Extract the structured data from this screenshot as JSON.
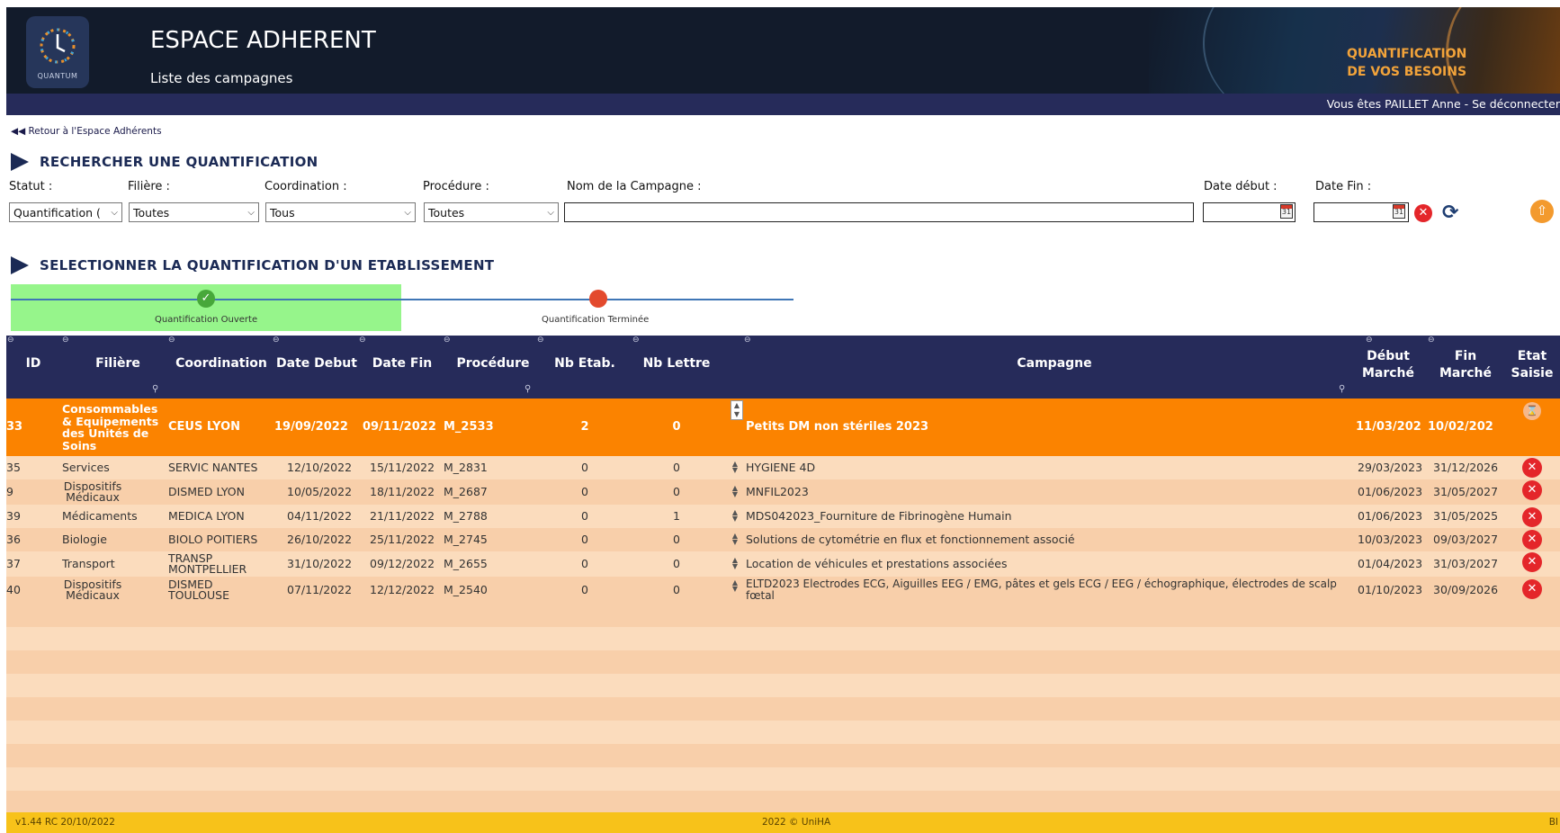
{
  "header": {
    "app_title": "ESPACE ADHERENT",
    "subtitle": "Liste des campagnes",
    "logo_label": "QUANTUM",
    "brand_line1": "QUANTIFICATION",
    "brand_line2": "DE VOS BESOINS"
  },
  "user_bar": {
    "text": "Vous êtes PAILLET Anne   - Se déconnecter"
  },
  "back_link": "◀◀ Retour à l'Espace Adhérents",
  "search": {
    "title": "RECHERCHER UNE QUANTIFICATION",
    "statut_label": "Statut :",
    "statut_value": "Quantification (",
    "filiere_label": "Filière :",
    "filiere_value": "Toutes",
    "coordination_label": "Coordination :",
    "coordination_value": "Tous",
    "procedure_label": "Procédure :",
    "procedure_value": "Toutes",
    "campagne_label": "Nom de la Campagne :",
    "campagne_value": "",
    "date_debut_label": "Date début :",
    "date_debut_value": "",
    "date_fin_label": "Date Fin :",
    "date_fin_value": "",
    "calendar_icon_text": "31"
  },
  "select": {
    "title": "SELECTIONNER LA  QUANTIFICATION D'UN ETABLISSEMENT",
    "steps": [
      "Quantification Ouverte",
      "Quantification Terminée"
    ],
    "active_step_index": 0
  },
  "table": {
    "headers": {
      "id": "ID",
      "filiere": "Filière",
      "coordination": "Coordination",
      "date_debut": "Date Debut",
      "date_fin": "Date Fin",
      "procedure": "Procédure",
      "nb_etab": "Nb Etab.",
      "nb_lettre": "Nb Lettre",
      "campagne": "Campagne",
      "debut_marche": "Début Marché",
      "fin_marche": "Fin Marché",
      "etat_saisie": "Etat Saisie"
    },
    "rows": [
      {
        "id": "33",
        "filiere": "Consommables & Equipements des Unités de Soins",
        "coordination": "CEUS LYON",
        "date_debut": "19/09/2022",
        "date_fin": "09/11/2022",
        "procedure": "M_2533",
        "nb_etab": "2",
        "nb_lettre": "0",
        "campagne": "Petits DM non stériles 2023",
        "debut_marche": "11/03/202",
        "fin_marche": "10/02/202",
        "selected": true,
        "etat_icon": "hourglass-icon"
      },
      {
        "id": "35",
        "filiere": "Services",
        "coordination": "SERVIC NANTES",
        "date_debut": "12/10/2022",
        "date_fin": "15/11/2022",
        "procedure": "M_2831",
        "nb_etab": "0",
        "nb_lettre": "0",
        "campagne": "HYGIENE 4D",
        "debut_marche": "29/03/2023",
        "fin_marche": "31/12/2026",
        "etat_icon": "close-icon"
      },
      {
        "id": "9",
        "filiere": "Dispositifs Médicaux",
        "coordination": "DISMED LYON",
        "date_debut": "10/05/2022",
        "date_fin": "18/11/2022",
        "procedure": "M_2687",
        "nb_etab": "0",
        "nb_lettre": "0",
        "campagne": "MNFIL2023",
        "debut_marche": "01/06/2023",
        "fin_marche": "31/05/2027",
        "etat_icon": "close-icon"
      },
      {
        "id": "39",
        "filiere": "Médicaments",
        "coordination": "MEDICA LYON",
        "date_debut": "04/11/2022",
        "date_fin": "21/11/2022",
        "procedure": "M_2788",
        "nb_etab": "0",
        "nb_lettre": "1",
        "campagne": "MDS042023_Fourniture de Fibrinogène Humain",
        "debut_marche": "01/06/2023",
        "fin_marche": "31/05/2025",
        "etat_icon": "close-icon"
      },
      {
        "id": "36",
        "filiere": "Biologie",
        "coordination": "BIOLO POITIERS",
        "date_debut": "26/10/2022",
        "date_fin": "25/11/2022",
        "procedure": "M_2745",
        "nb_etab": "0",
        "nb_lettre": "0",
        "campagne": "Solutions de cytométrie en flux et fonctionnement associé",
        "debut_marche": "10/03/2023",
        "fin_marche": "09/03/2027",
        "etat_icon": "close-icon"
      },
      {
        "id": "37",
        "filiere": "Transport",
        "coordination": "TRANSP MONTPELLIER",
        "date_debut": "31/10/2022",
        "date_fin": "09/12/2022",
        "procedure": "M_2655",
        "nb_etab": "0",
        "nb_lettre": "0",
        "campagne": "Location de véhicules et prestations associées",
        "debut_marche": "01/04/2023",
        "fin_marche": "31/03/2027",
        "etat_icon": "close-icon"
      },
      {
        "id": "40",
        "filiere": "Dispositifs Médicaux",
        "coordination": "DISMED TOULOUSE",
        "date_debut": "07/11/2022",
        "date_fin": "12/12/2022",
        "procedure": "M_2540",
        "nb_etab": "0",
        "nb_lettre": "0",
        "campagne": "ELTD2023 Electrodes ECG, Aiguilles EEG / EMG, pâtes et gels ECG / EEG / échographique, électrodes de scalp fœtal",
        "debut_marche": "01/10/2023",
        "fin_marche": "30/09/2026",
        "etat_icon": "close-icon"
      }
    ]
  },
  "footer": {
    "version": "v1.44 RC 20/10/2022",
    "copyright": "2022 © UniHA",
    "right": "BI"
  },
  "colors": {
    "header_bg": "#121b2b",
    "nav_bar": "#262b5a",
    "selected_row": "#fb8300",
    "row_light": "#fbdcbd",
    "row_dark": "#f8cfaa",
    "footer": "#f7c21a",
    "step_active": "#96f58b"
  }
}
